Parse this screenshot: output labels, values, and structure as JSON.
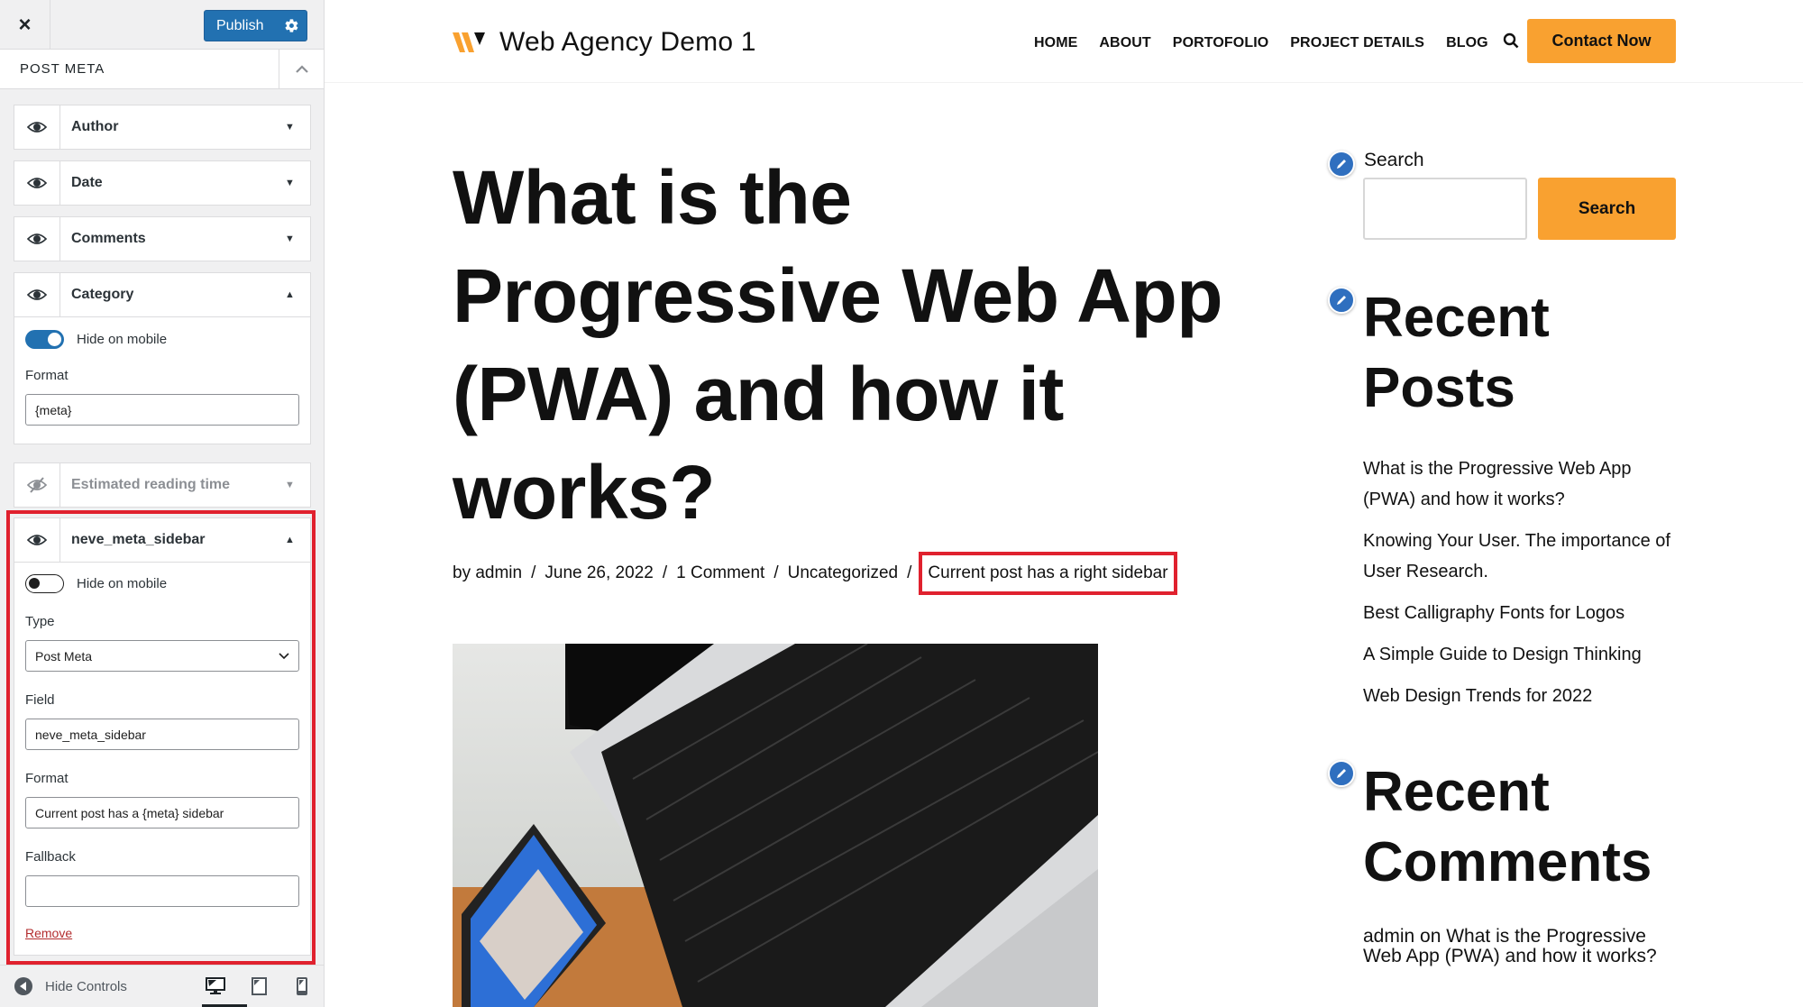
{
  "customizer": {
    "close_label": "×",
    "publish_label": "Publish",
    "section_title": "POST META",
    "meta_items": [
      {
        "label": "Author",
        "visible": true,
        "expanded": false
      },
      {
        "label": "Date",
        "visible": true,
        "expanded": false
      },
      {
        "label": "Comments",
        "visible": true,
        "expanded": false
      },
      {
        "label": "Category",
        "visible": true,
        "expanded": true,
        "hide_on_mobile_label": "Hide on mobile",
        "hide_on_mobile": true,
        "format_label": "Format",
        "format_value": "{meta}"
      },
      {
        "label": "Estimated reading time",
        "visible": false,
        "expanded": false
      },
      {
        "label": "neve_meta_sidebar",
        "visible": true,
        "expanded": true,
        "hide_on_mobile_label": "Hide on mobile",
        "hide_on_mobile": false,
        "type_label": "Type",
        "type_value": "Post Meta",
        "field_label": "Field",
        "field_value": "neve_meta_sidebar",
        "format_label": "Format",
        "format_value": "Current post has a {meta} sidebar",
        "fallback_label": "Fallback",
        "fallback_value": "",
        "remove_label": "Remove"
      }
    ],
    "footer": {
      "hide_controls_label": "Hide Controls",
      "devices": [
        "desktop",
        "tablet",
        "mobile"
      ],
      "active_device": "desktop"
    }
  },
  "site": {
    "logo_text": "Web Agency Demo 1",
    "nav": [
      "HOME",
      "ABOUT",
      "PORTOFOLIO",
      "PROJECT DETAILS",
      "BLOG"
    ],
    "cta_label": "Contact Now",
    "post": {
      "title": "What is the Progressive Web App (PWA) and how it works?",
      "meta": {
        "author": "by admin",
        "date": "June 26, 2022",
        "comments": "1 Comment",
        "category": "Uncategorized",
        "custom": "Current post has a right sidebar"
      },
      "image_alt": "Laptop keyboard and smartphone showing Facebook"
    },
    "widgets": {
      "search_label": "Search",
      "search_button": "Search",
      "search_value": "",
      "recent_posts_title": "Recent Posts",
      "recent_posts": [
        "What is the Progressive Web App (PWA) and how it works?",
        "Knowing Your User. The importance of User Research.",
        "Best Calligraphy Fonts for Logos",
        "A Simple Guide to Design Thinking",
        "Web Design Trends for 2022"
      ],
      "recent_comments_title": "Recent Comments",
      "recent_comment": "admin on What is the Progressive Web App (PWA) and how it works?"
    }
  },
  "colors": {
    "wp_blue": "#2271b1",
    "accent_orange": "#f9a130",
    "highlight_red": "#e0212e",
    "pencil_blue": "#2f6fbf"
  }
}
